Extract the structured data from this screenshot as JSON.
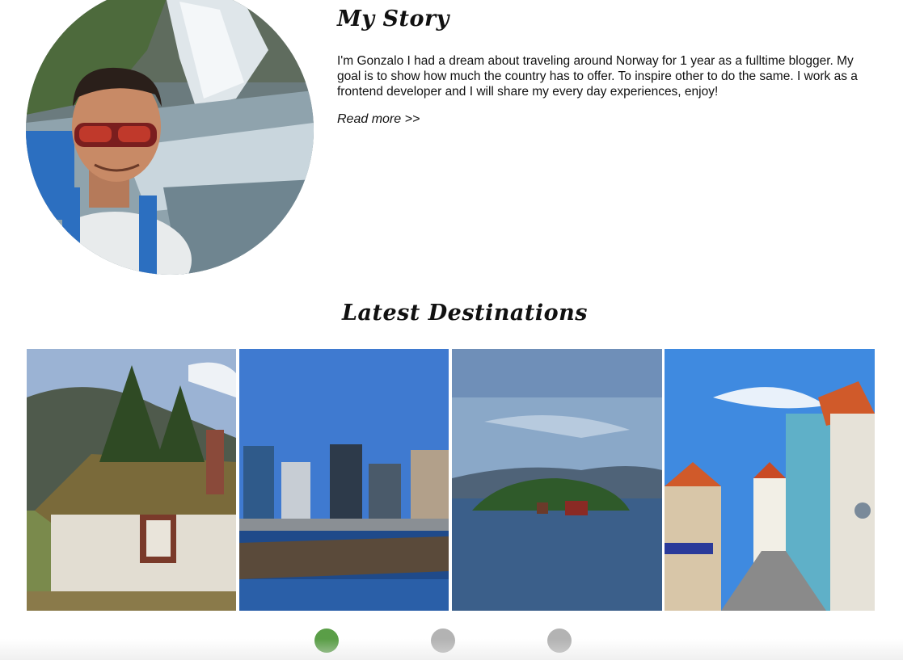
{
  "story": {
    "title": "My Story",
    "text": "I'm Gonzalo I had a dream about traveling around Norway for 1 year as a fulltime blogger. My goal is to show how much the country has to offer. To inspire other to do the same. I work as a frontend developer and I will share my every day experiences, enjoy!",
    "read_more": "Read more >>"
  },
  "destinations": {
    "title": "Latest Destinations",
    "photos": [
      "turf-roof-cabin",
      "oslo-barcode-waterfront",
      "fjord-island",
      "stavanger-street"
    ]
  },
  "carousel": {
    "active_index": 0,
    "dot_count": 3,
    "active_color": "#5a9e47",
    "inactive_color": "#b3b3b3"
  }
}
